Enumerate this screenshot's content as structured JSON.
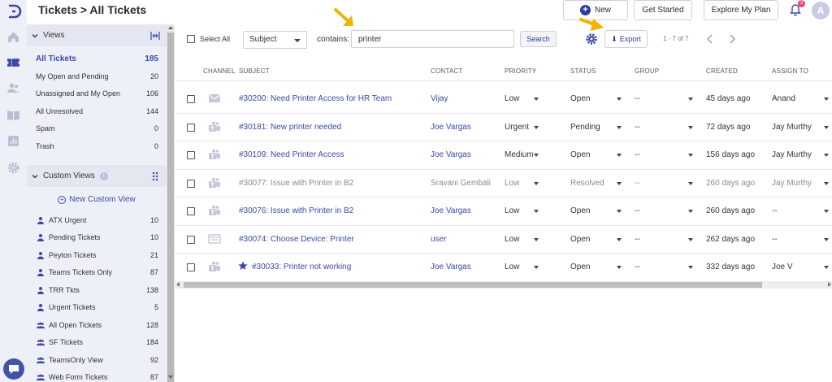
{
  "header": {
    "title": "Tickets > All Tickets",
    "new_label": "New",
    "get_started_label": "Get Started",
    "explore_label": "Explore My Plan",
    "notification_count": "3",
    "avatar_initial": "A"
  },
  "icons": {
    "rail": [
      "logo-icon",
      "home-icon",
      "tickets-icon",
      "contacts-icon",
      "knowledge-base-icon",
      "reports-icon",
      "settings-icon"
    ],
    "chat": "chat-icon"
  },
  "sidebar": {
    "views_title": "Views",
    "views": [
      {
        "label": "All Tickets",
        "count": "185",
        "active": true
      },
      {
        "label": "My Open and Pending",
        "count": "20"
      },
      {
        "label": "Unassigned and My Open",
        "count": "106"
      },
      {
        "label": "All Unresolved",
        "count": "144"
      },
      {
        "label": "Spam",
        "count": "0"
      },
      {
        "label": "Trash",
        "count": "0"
      }
    ],
    "custom_views_title": "Custom Views",
    "custom_views_info": "i",
    "new_custom_view_label": "New Custom View",
    "custom_views": [
      {
        "label": "ATX Urgent",
        "count": "10",
        "icon": "person-icon"
      },
      {
        "label": "Pending Tickets",
        "count": "10",
        "icon": "person-icon"
      },
      {
        "label": "Peyton Tickets",
        "count": "21",
        "icon": "person-icon"
      },
      {
        "label": "Teams Tickets Only",
        "count": "87",
        "icon": "person-icon"
      },
      {
        "label": "TRR Tkts",
        "count": "138",
        "icon": "person-icon"
      },
      {
        "label": "Urgent Tickets",
        "count": "5",
        "icon": "person-icon"
      },
      {
        "label": "All Open Tickets",
        "count": "128",
        "icon": "group-icon"
      },
      {
        "label": "SF Tickets",
        "count": "184",
        "icon": "group-icon"
      },
      {
        "label": "TeamsOnly View",
        "count": "92",
        "icon": "group-icon"
      },
      {
        "label": "Web Form Tickets",
        "count": "87",
        "icon": "group-icon"
      }
    ]
  },
  "filter": {
    "select_all_label": "Select All",
    "field_value": "Subject",
    "contains_label": "contains:",
    "search_value": "printer",
    "search_button": "Search",
    "export_label": "Export",
    "pagination": "1 - 7 of 7"
  },
  "table": {
    "columns": [
      "Channel",
      "Subject",
      "Contact",
      "Priority",
      "Status",
      "Group",
      "Created",
      "Assign To"
    ],
    "rows": [
      {
        "channel": "email-icon",
        "subject": "#30200: Need Printer Access for HR Team",
        "contact": "Vijay",
        "priority": "Low",
        "status": "Open",
        "group": "--",
        "created": "45 days ago",
        "assign": "Anand",
        "muted": false,
        "starred": false
      },
      {
        "channel": "teams-icon",
        "subject": "#30181: New printer needed",
        "contact": "Joe Vargas",
        "priority": "Urgent",
        "status": "Pending",
        "group": "--",
        "created": "72 days ago",
        "assign": "Jay Murthy",
        "muted": false,
        "starred": false
      },
      {
        "channel": "teams-icon",
        "subject": "#30109: Need Printer Access",
        "contact": "Joe Vargas",
        "priority": "Medium",
        "status": "Open",
        "group": "--",
        "created": "156 days ago",
        "assign": "Jay Murthy",
        "muted": false,
        "starred": false
      },
      {
        "channel": "teams-icon",
        "subject": "#30077: Issue with Printer in B2",
        "contact": "Sravani Gembali",
        "priority": "Low",
        "status": "Resolved",
        "group": "--",
        "created": "260 days ago",
        "assign": "Jay Murthy",
        "muted": true,
        "starred": false
      },
      {
        "channel": "teams-icon",
        "subject": "#30076: Issue with Printer in B2",
        "contact": "Joe Vargas",
        "priority": "Low",
        "status": "Open",
        "group": "--",
        "created": "260 days ago",
        "assign": "--",
        "muted": false,
        "starred": false
      },
      {
        "channel": "webform-icon",
        "subject": "#30074: Choose Device: Printer",
        "contact": "user",
        "priority": "Low",
        "status": "Open",
        "group": "--",
        "created": "262 days ago",
        "assign": "--",
        "muted": false,
        "starred": false
      },
      {
        "channel": "teams-icon",
        "subject": "#30033: Printer not working",
        "contact": "Joe Vargas",
        "priority": "Low",
        "status": "Open",
        "group": "--",
        "created": "332 days ago",
        "assign": "Joe V",
        "muted": false,
        "starred": true
      }
    ]
  },
  "colors": {
    "accent": "#3b48a8",
    "annotation_arrow": "#f0b400",
    "sidebar_bg": "#eef0f7",
    "badge": "#e9437a"
  }
}
